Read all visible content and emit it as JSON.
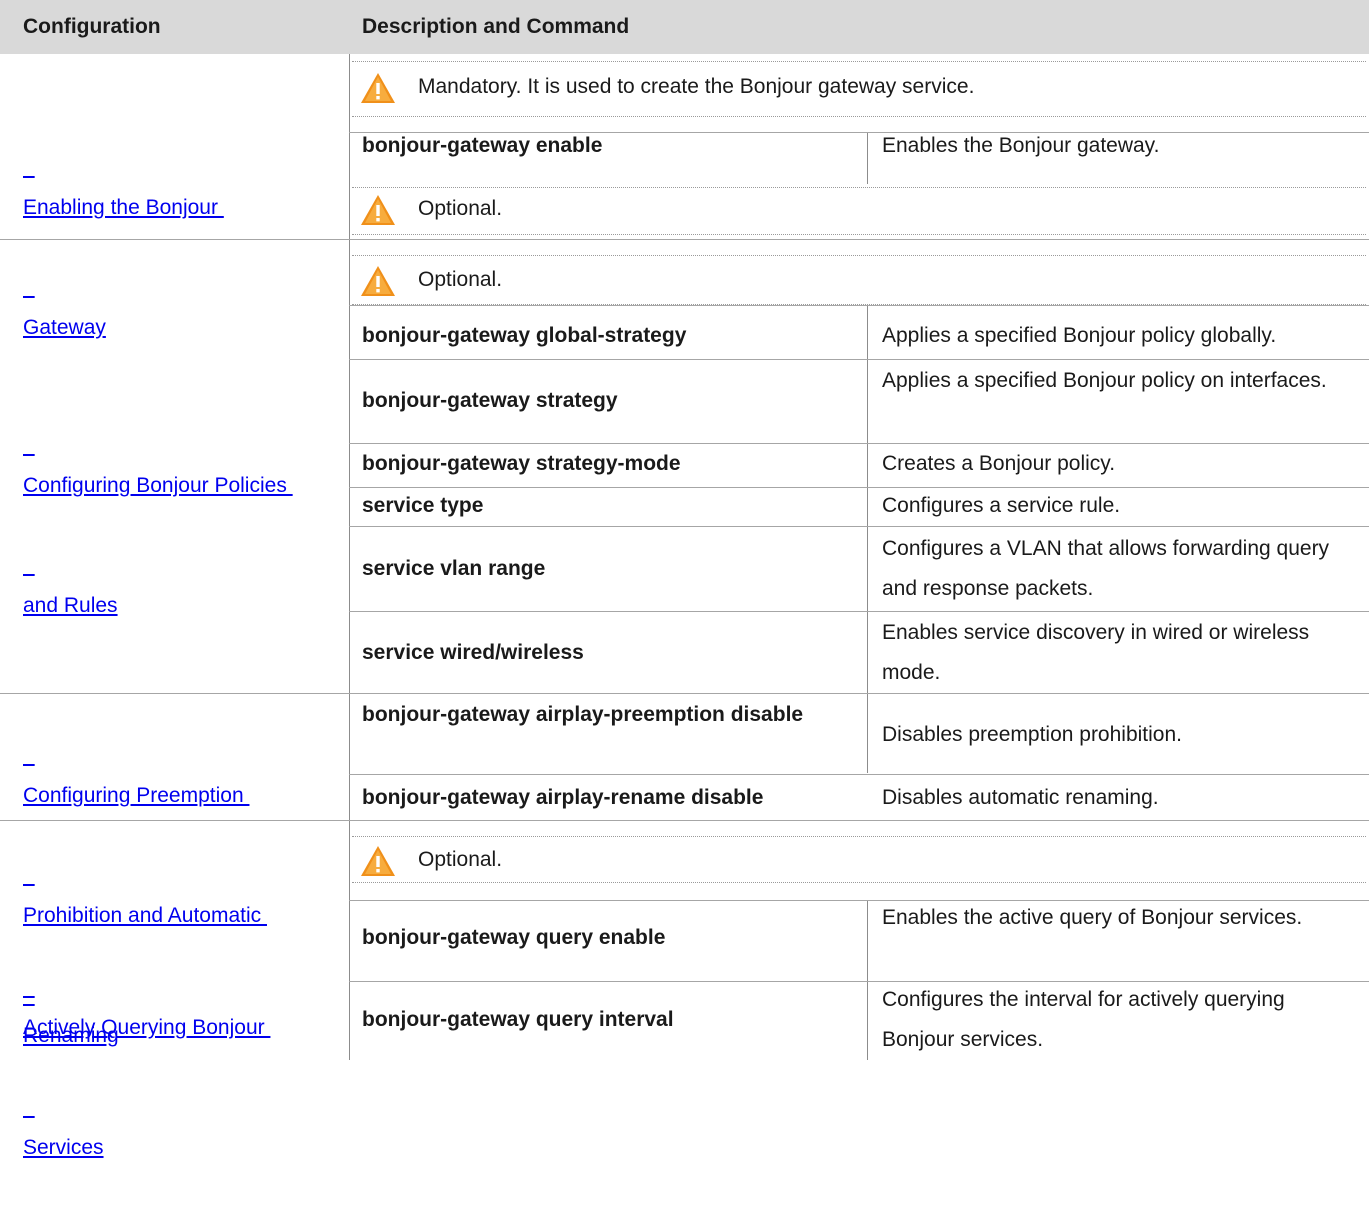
{
  "header": {
    "configuration": "Configuration",
    "description": "Description and Command"
  },
  "colors": {
    "header_bg": "#d9d9d9",
    "link": "#0000ee",
    "warning_orange": "#f0901a"
  },
  "icons": {
    "warning": "warning-triangle-icon"
  },
  "sections": [
    {
      "title_lines": [
        "Enabling the Bonjour ",
        "Gateway"
      ],
      "notes": [
        "Mandatory. It is used to create the Bonjour gateway service.",
        "Optional."
      ],
      "rows": [
        {
          "command": "bonjour-gateway enable",
          "description": "Enables the Bonjour gateway."
        }
      ]
    },
    {
      "title_lines": [
        "Configuring Bonjour Policies ",
        "and Rules"
      ],
      "notes": [
        "Optional."
      ],
      "rows": [
        {
          "command": "bonjour-gateway global-strategy",
          "description": "Applies a specified Bonjour policy globally."
        },
        {
          "command": "bonjour-gateway strategy",
          "description": "Applies a specified Bonjour policy on interfaces."
        },
        {
          "command": "bonjour-gateway strategy-mode",
          "description": "Creates a Bonjour policy."
        },
        {
          "command": "service type",
          "description": "Configures a service rule."
        },
        {
          "command": "service vlan range",
          "description": "Configures a VLAN that allows forwarding query and response packets."
        },
        {
          "command": "service wired/wireless",
          "description": "Enables service discovery in wired or wireless mode."
        }
      ]
    },
    {
      "title_lines": [
        "Configuring Preemption ",
        "Prohibition and Automatic ",
        "Renaming"
      ],
      "rows": [
        {
          "command": "bonjour-gateway airplay-preemption disable",
          "description": "Disables preemption prohibition."
        },
        {
          "command": "bonjour-gateway airplay-rename disable",
          "description": "Disables automatic renaming."
        }
      ]
    },
    {
      "title_lines": [
        "Actively Querying Bonjour ",
        "Services"
      ],
      "notes": [
        "Optional."
      ],
      "rows": [
        {
          "command": "bonjour-gateway query enable",
          "description": "Enables the active query of Bonjour services."
        },
        {
          "command": "bonjour-gateway query interval",
          "description": "Configures the interval for actively querying Bonjour services."
        }
      ]
    }
  ]
}
